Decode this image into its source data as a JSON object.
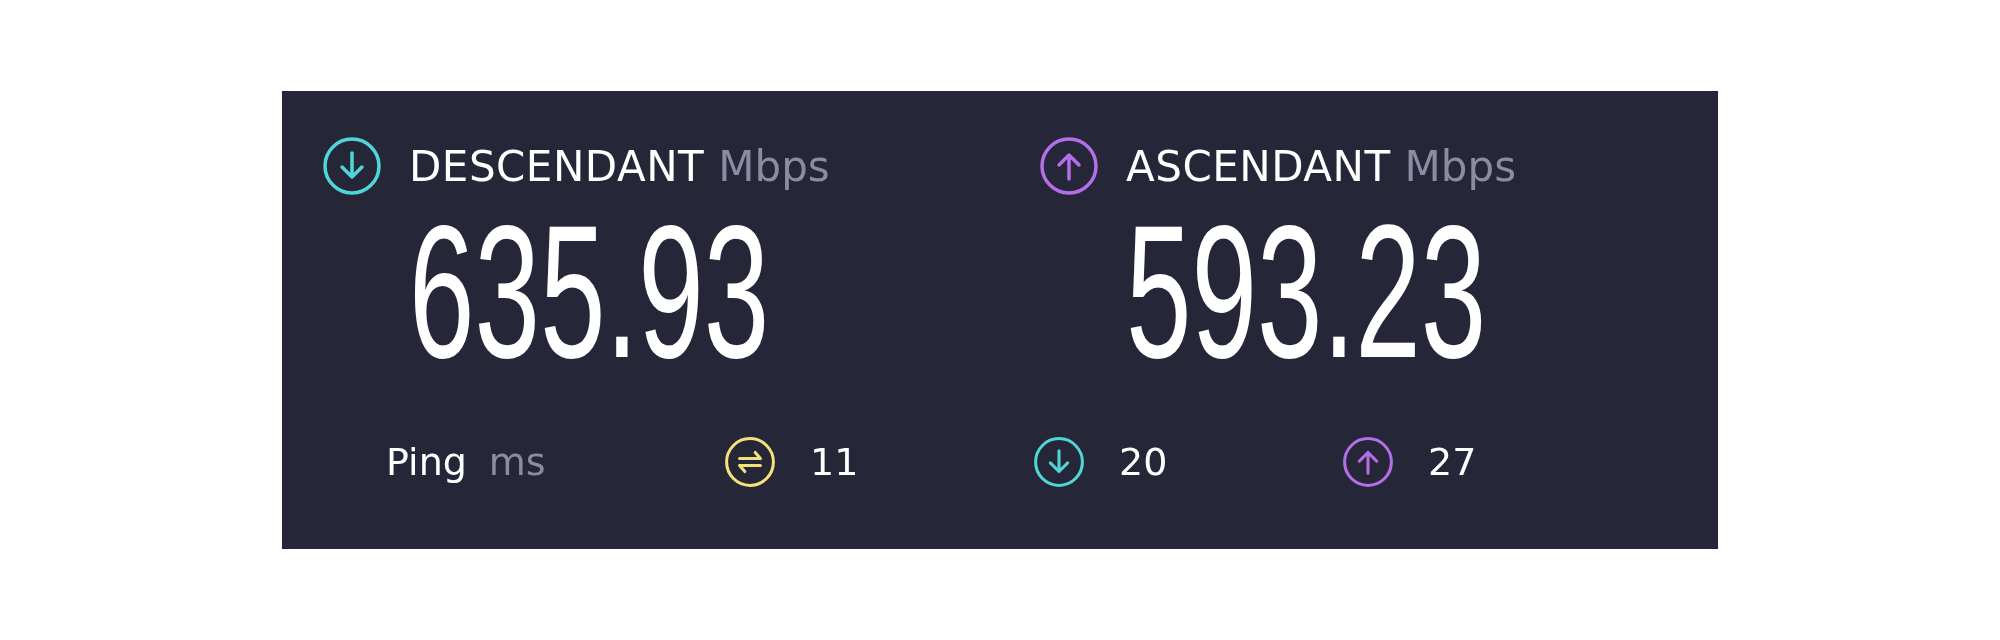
{
  "results": [
    {
      "kind": "download",
      "label": "DESCENDANT",
      "unit": "Mbps",
      "value": "635.93"
    },
    {
      "kind": "upload",
      "label": "ASCENDANT",
      "unit": "Mbps",
      "value": "593.23"
    }
  ],
  "ping": {
    "label": "Ping",
    "unit": "ms",
    "items": [
      {
        "kind": "idle",
        "value": "11"
      },
      {
        "kind": "download",
        "value": "20"
      },
      {
        "kind": "upload",
        "value": "27"
      }
    ]
  }
}
